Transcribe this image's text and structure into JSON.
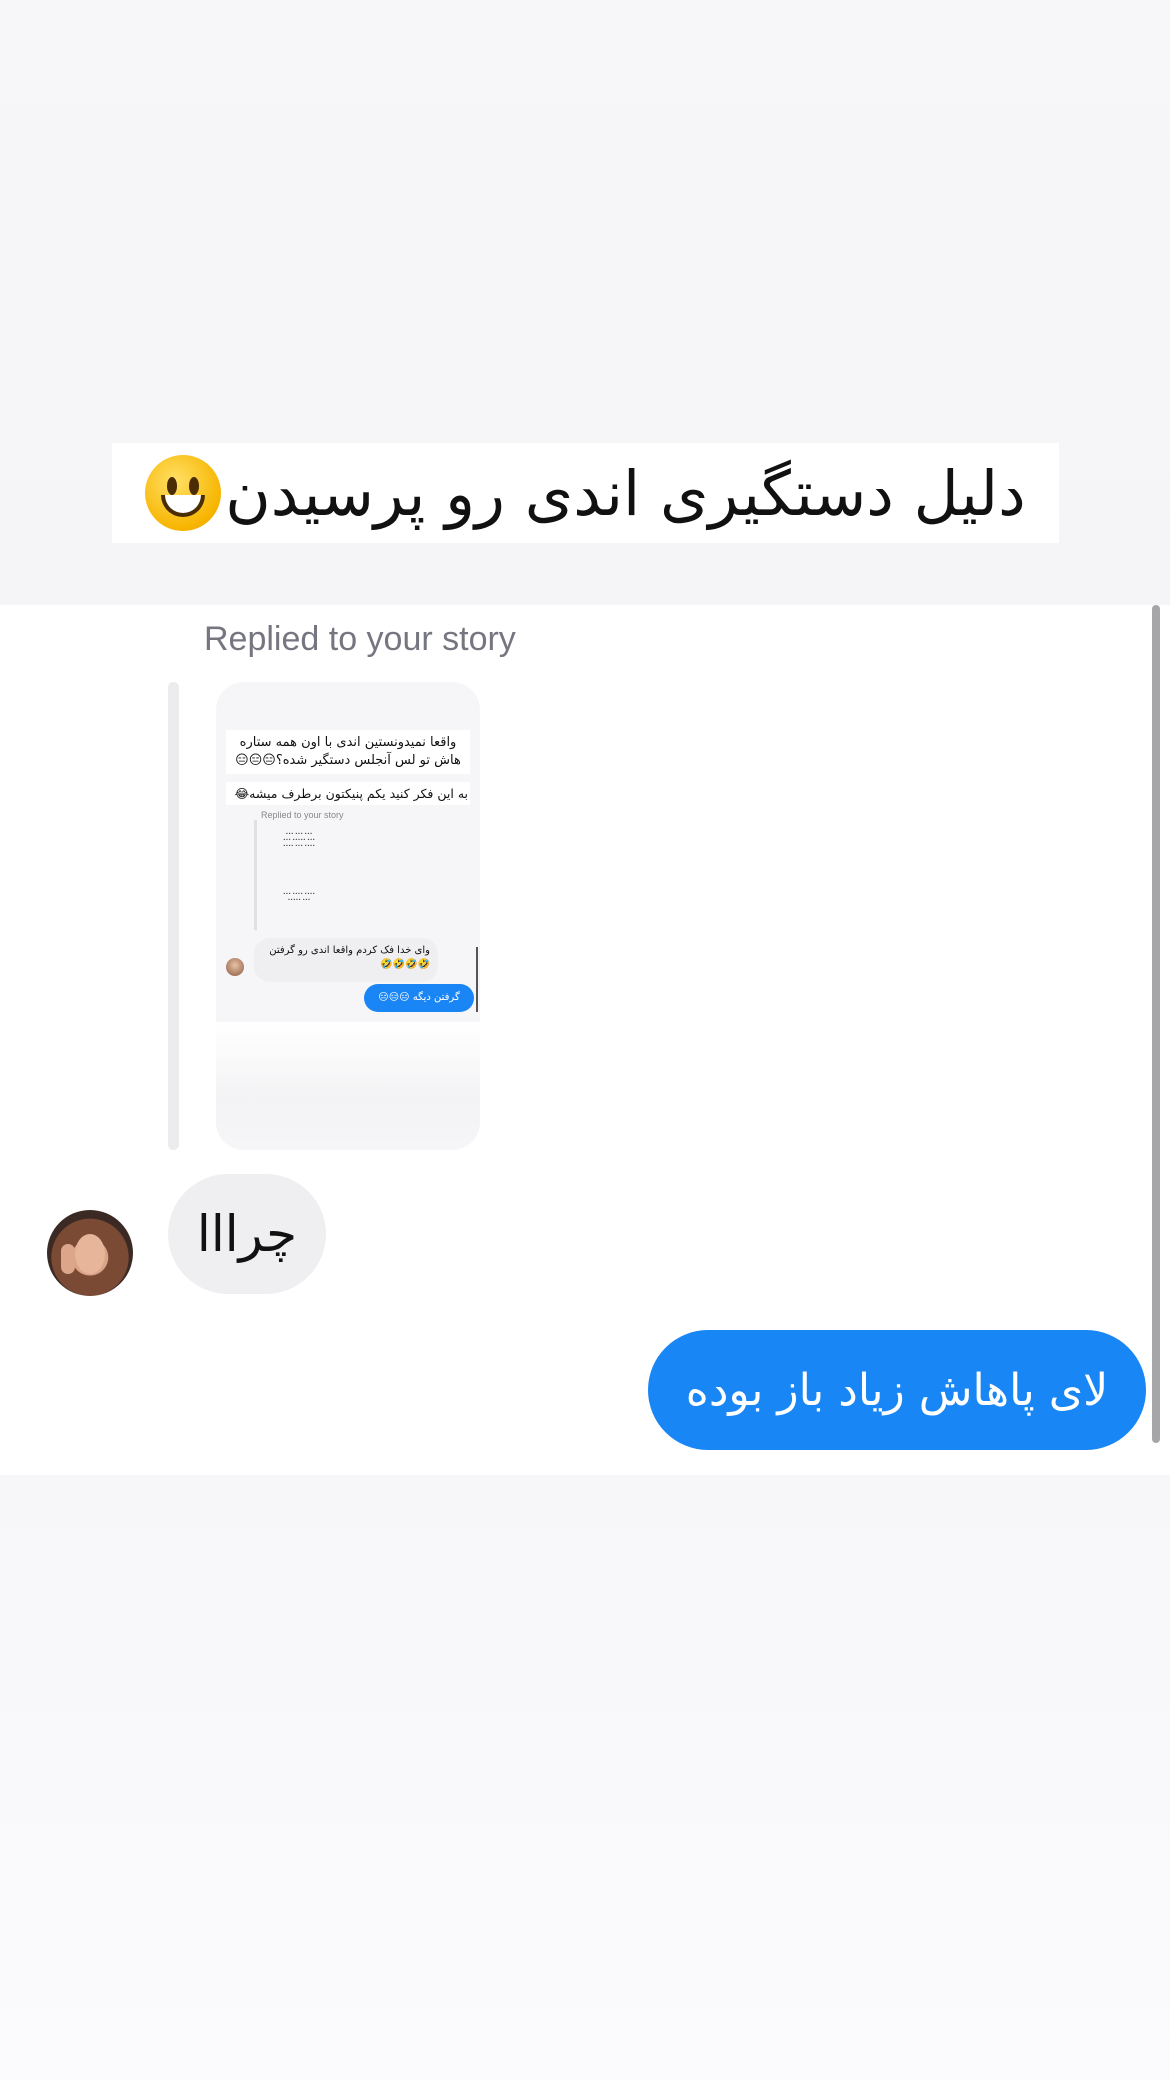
{
  "caption": {
    "text": "دلیل دستگیری اندی رو پرسیدن",
    "emoji": "grinning-face-emoji"
  },
  "chat": {
    "replied_label": "Replied to your story",
    "story_thumbnail": {
      "caption_line1": "واقعا نمیدونستین اندی با اون همه ستاره هاش تو لس آنجلس دستگیر شده؟😑😑😑",
      "caption_line2": "به این فکر کنید یکم پنیکتون برطرف میشه😂",
      "replied_label": "Replied to your story",
      "incoming_text": "وای خدا فک کردم واقعا اندی رو گرفتن 🤣🤣🤣🤣",
      "outgoing_text": "گرفتن دیگه 😑😑😑"
    },
    "incoming_message": "چرااا",
    "outgoing_message": "لای پاهاش زیاد باز بوده"
  },
  "colors": {
    "outgoing_bubble": "#1986f6",
    "incoming_bubble": "#efeff1",
    "label_gray": "#767680"
  }
}
